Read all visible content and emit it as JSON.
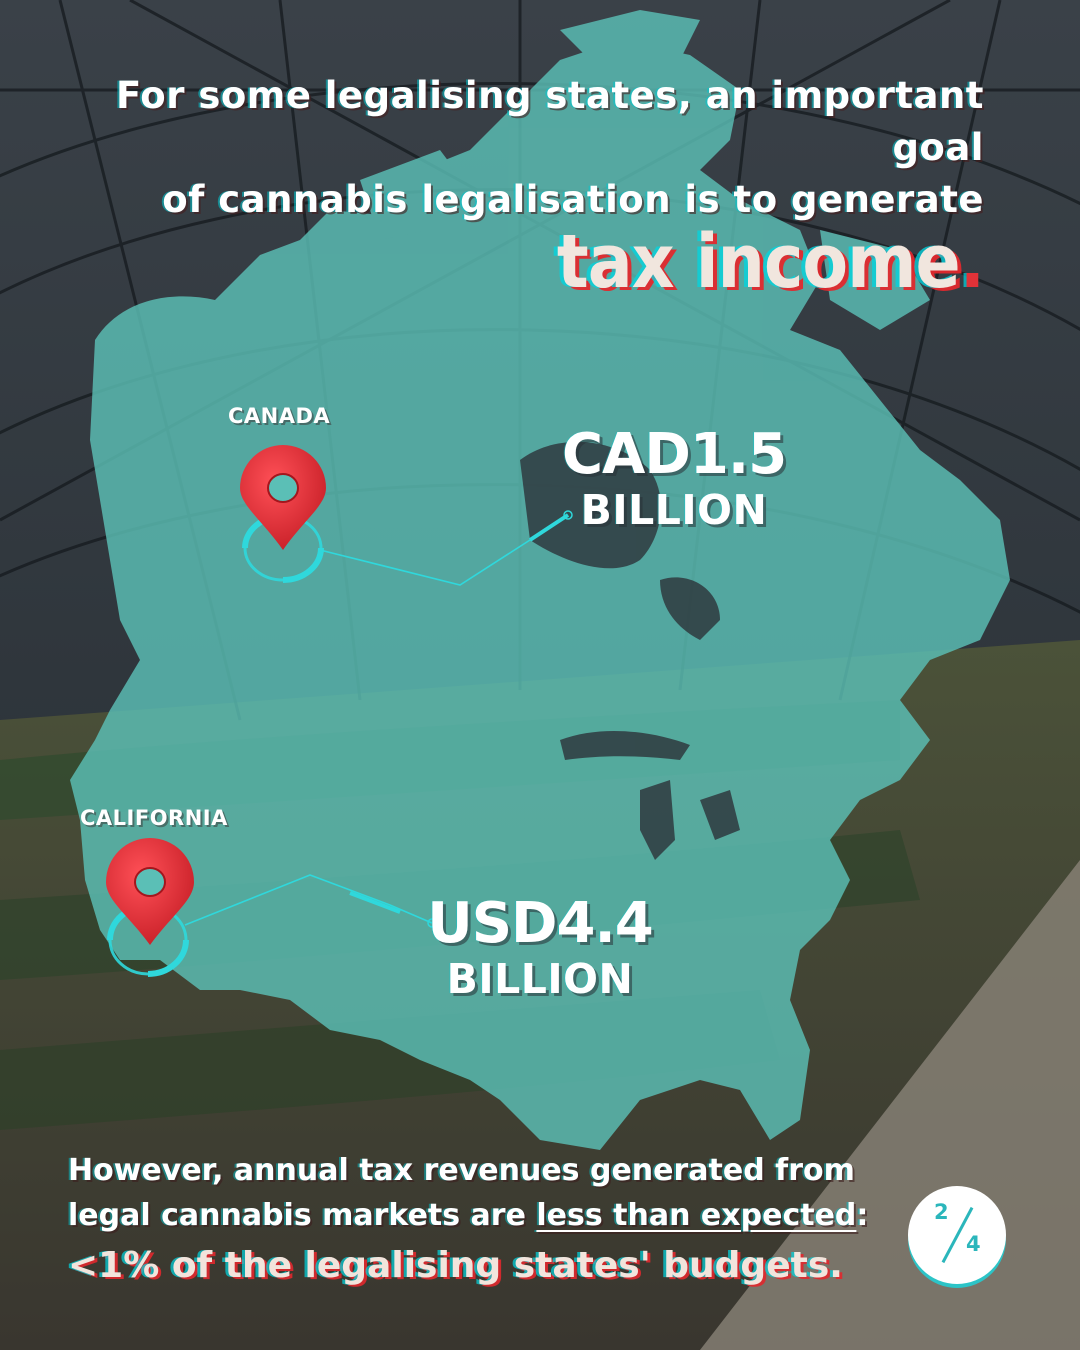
{
  "headline": {
    "line1": "For some legalising states, an important goal",
    "line2": "of cannabis legalisation is to generate",
    "emphasis": "tax income",
    "emphasis_punct": "."
  },
  "markers": [
    {
      "label": "CANADA",
      "value": "CAD1.5",
      "unit": "BILLION"
    },
    {
      "label": "CALIFORNIA",
      "value": "USD4.4",
      "unit": "BILLION"
    }
  ],
  "footer": {
    "line1": "However, annual tax revenues generated from",
    "line2_pre": "legal cannabis markets are ",
    "line2_underlined": "less than expected",
    "line2_post": ":",
    "line3": "<1% of the legalising states' budgets."
  },
  "pagination": {
    "current": "2",
    "total": "4"
  },
  "colors": {
    "map_fill": "#5bbfb6",
    "accent_red": "#e23238",
    "accent_cyan": "#2cc4c7"
  },
  "icons": [
    "location-pin-icon",
    "location-pin-icon"
  ]
}
